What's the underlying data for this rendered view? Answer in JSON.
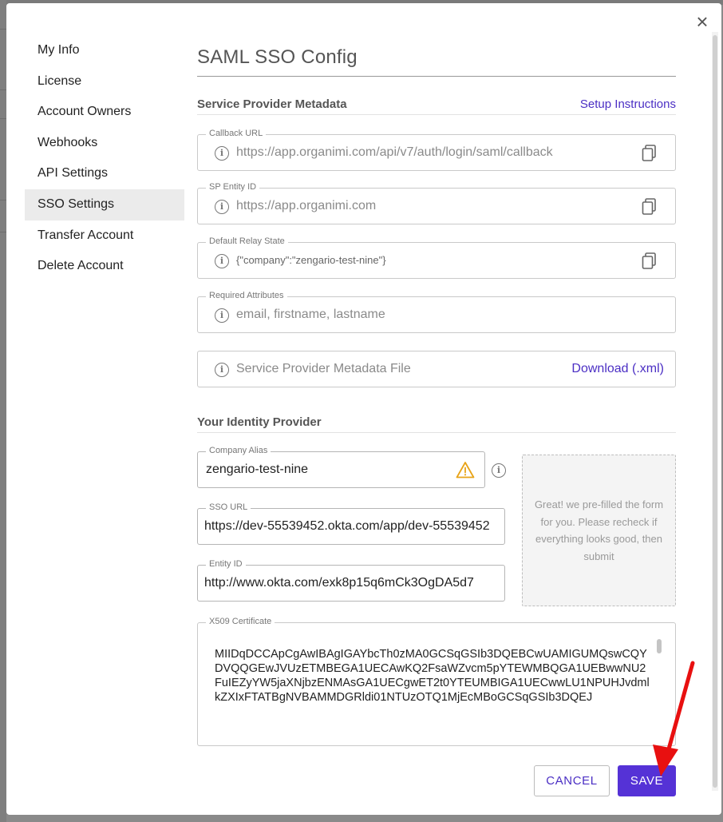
{
  "sidebar": {
    "items": [
      {
        "label": "My Info"
      },
      {
        "label": "License"
      },
      {
        "label": "Account Owners"
      },
      {
        "label": "Webhooks"
      },
      {
        "label": "API Settings"
      },
      {
        "label": "SSO Settings",
        "active": true
      },
      {
        "label": "Transfer Account"
      },
      {
        "label": "Delete Account"
      }
    ]
  },
  "page": {
    "title": "SAML SSO Config",
    "close_label": "×"
  },
  "service_provider": {
    "section_title": "Service Provider Metadata",
    "setup_link": "Setup Instructions",
    "callback_url": {
      "label": "Callback URL",
      "value": "https://app.organimi.com/api/v7/auth/login/saml/callback"
    },
    "sp_entity_id": {
      "label": "SP Entity ID",
      "value": "https://app.organimi.com"
    },
    "relay_state": {
      "label": "Default Relay State",
      "value": "{\"company\":\"zengario-test-nine\"}"
    },
    "required_attributes": {
      "label": "Required Attributes",
      "value": "email, firstname, lastname"
    },
    "metadata_file": {
      "label": "Service Provider Metadata File",
      "download_label": "Download (.xml)"
    }
  },
  "identity_provider": {
    "section_title": "Your Identity Provider",
    "company_alias": {
      "label": "Company Alias",
      "value": "zengario-test-nine"
    },
    "sso_url": {
      "label": "SSO URL",
      "value": "https://dev-55539452.okta.com/app/dev-55539452"
    },
    "entity_id": {
      "label": "Entity ID",
      "value": "http://www.okta.com/exk8p15q6mCk3OgDA5d7"
    },
    "hint": "Great! we pre-filled the form for you. Please recheck if everything looks good, then submit",
    "x509": {
      "label": "X509 Certificate",
      "value": "MIIDqDCCApCgAwIBAgIGAYbcTh0zMA0GCSqGSIb3DQEBCwUAMIGUMQswCQYDVQQGEwJVUzETMBEGA1UECAwKQ2FsaWZvcm5pYTEWMBQGA1UEBwwNU2FuIEZyYW5jaXNjbzENMAsGA1UECgwET2t0YTEUMBIGA1UECwwLU1NPUHJvdmlkZXIxFTATBgNVBAMMDGRldi01NTUzOTQ1MjEcMBoGCSqGSIb3DQEJ"
    }
  },
  "actions": {
    "cancel_label": "CANCEL",
    "save_label": "SAVE"
  },
  "colors": {
    "accent": "#5532d6",
    "link": "#4b2fc4",
    "warning": "#e8a317",
    "annotation_arrow": "#e81010"
  }
}
